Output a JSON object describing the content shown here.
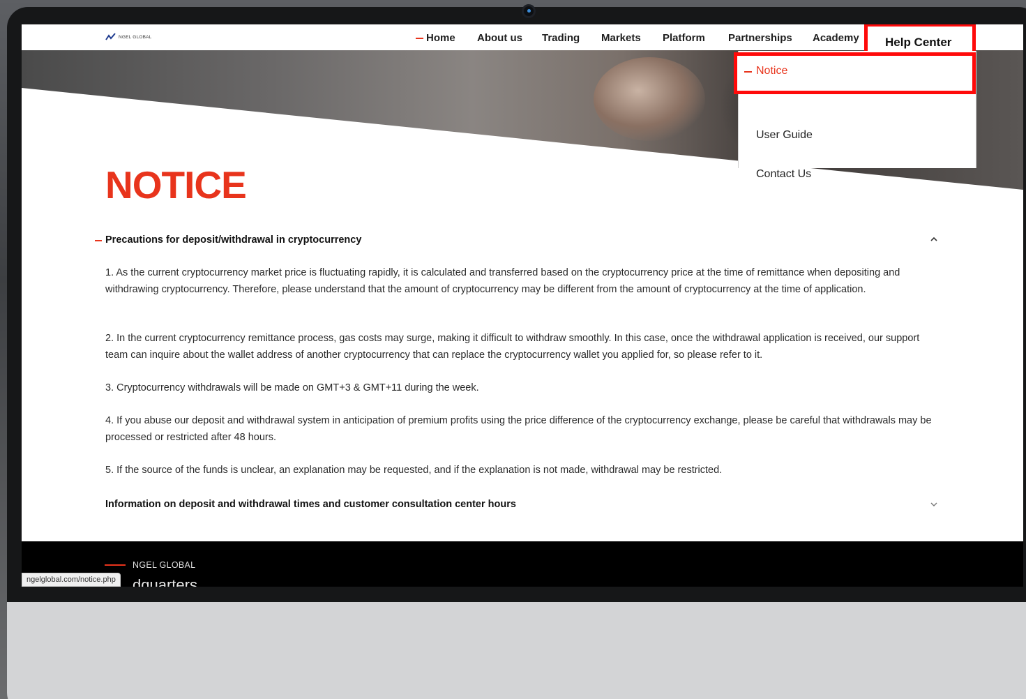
{
  "site": {
    "logo_text": "NGEL GLOBAL"
  },
  "nav": {
    "items": [
      {
        "label": "Home"
      },
      {
        "label": "About us"
      },
      {
        "label": "Trading"
      },
      {
        "label": "Markets"
      },
      {
        "label": "Platform"
      },
      {
        "label": "Partnerships"
      },
      {
        "label": "Academy"
      },
      {
        "label": "Help Center"
      }
    ],
    "dropdown": [
      {
        "label": "Notice"
      },
      {
        "label": "User Guide"
      },
      {
        "label": "Contact Us"
      }
    ]
  },
  "page": {
    "title": "NOTICE",
    "accordion": [
      {
        "heading": "Precautions for deposit/withdrawal in cryptocurrency",
        "expanded": true,
        "paragraphs": [
          "1. As the current cryptocurrency market price is fluctuating rapidly, it is calculated and transferred based on the cryptocurrency price at the time of remittance when depositing and withdrawing cryptocurrency. Therefore, please understand that the amount of cryptocurrency may be different from the amount of cryptocurrency at the time of application.",
          "2. In the current cryptocurrency remittance process, gas costs may surge, making it difficult to withdraw smoothly. In this case, once the withdrawal application is received, our support team can inquire about the wallet address of another cryptocurrency that can replace the cryptocurrency wallet you applied for, so please refer to it.",
          "3. Cryptocurrency withdrawals will be made on GMT+3 & GMT+11 during the week.",
          "4. If you abuse our deposit and withdrawal system in anticipation of premium profits using the price difference of the cryptocurrency exchange, please be careful that withdrawals may be processed or restricted after 48 hours.",
          "5. If the source of the funds is unclear, an explanation may be requested, and if the explanation is not made, withdrawal may be restricted."
        ]
      },
      {
        "heading": "Information on deposit and withdrawal times and customer consultation center hours",
        "expanded": false
      }
    ]
  },
  "footer": {
    "brand": "NGEL GLOBAL",
    "partial_heading": "dquarters"
  },
  "status_bar": {
    "url": "ngelglobal.com/notice.php"
  },
  "colors": {
    "accent": "#e8341c",
    "highlight_box": "#ff0a0a",
    "footer_bg": "#000000"
  },
  "icons": {
    "expanded": "chevron-up-icon",
    "collapsed": "chevron-down-icon"
  }
}
